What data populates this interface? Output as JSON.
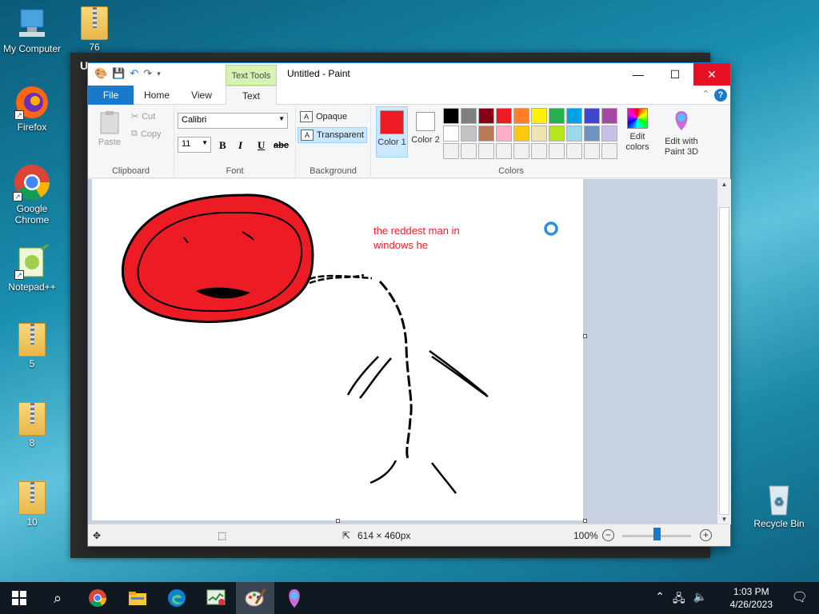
{
  "desktop": {
    "icons": [
      {
        "label": "My Computer"
      },
      {
        "label": "76"
      },
      {
        "label": "Firefox"
      },
      {
        "label": "Google Chrome"
      },
      {
        "label": "Notepad++"
      },
      {
        "label": "5"
      },
      {
        "label": "8"
      },
      {
        "label": "10"
      },
      {
        "label": "Recycle Bin"
      }
    ]
  },
  "bg_window": {
    "title": "U"
  },
  "paint": {
    "title": "Untitled - Paint",
    "context_tab": "Text Tools",
    "tabs": [
      "File",
      "Home",
      "View",
      "Text"
    ],
    "clipboard": {
      "paste": "Paste",
      "cut": "Cut",
      "copy": "Copy",
      "label": "Clipboard"
    },
    "font": {
      "family": "Calibri",
      "size": "11",
      "bold": "B",
      "italic": "I",
      "underline": "U",
      "strike": "abc",
      "label": "Font"
    },
    "background": {
      "opaque": "Opaque",
      "transparent": "Transparent",
      "label": "Background"
    },
    "colors": {
      "color1": "Color 1",
      "color2": "Color 2",
      "color1_value": "#ed1c24",
      "color2_value": "#ffffff",
      "edit_colors": "Edit colors",
      "edit_3d": "Edit with Paint 3D",
      "label": "Colors",
      "palette": [
        "#000000",
        "#7f7f7f",
        "#880015",
        "#ed1c24",
        "#ff7f27",
        "#fff200",
        "#22b14c",
        "#00a2e8",
        "#3f48cc",
        "#a349a4",
        "#ffffff",
        "#c3c3c3",
        "#b97a57",
        "#ffaec9",
        "#ffc90e",
        "#efe4b0",
        "#b5e61d",
        "#99d9ea",
        "#7092be",
        "#c8bfe7",
        "#ffffff",
        "#ffffff",
        "#ffffff",
        "#ffffff",
        "#ffffff",
        "#ffffff",
        "#ffffff",
        "#ffffff",
        "#ffffff",
        "#ffffff"
      ]
    },
    "canvas_text": [
      "the reddest man in",
      "windows he"
    ],
    "status": {
      "dimensions": "614 × 460px",
      "zoom": "100%"
    }
  },
  "taskbar": {
    "time": "1:03 PM",
    "date": "4/26/2023",
    "apps": [
      "start-icon",
      "search-icon",
      "chrome-icon",
      "file-explorer-icon",
      "edge-icon",
      "task-manager-icon",
      "paint-icon",
      "paint3d-icon"
    ]
  }
}
